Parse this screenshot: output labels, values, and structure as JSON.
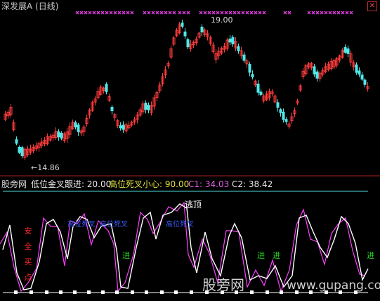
{
  "window": {
    "title": "深发展A (日线)",
    "close_icon": "close-icon"
  },
  "price_chart": {
    "high_label": "19.00",
    "low_label": "←14.86",
    "up_color": "#ff3c3c",
    "down_color": "#4fe8e8",
    "marker_color": "#e040e0"
  },
  "indicator": {
    "name": "股旁网",
    "param1": "低位金叉跟进: 20.00",
    "param2": "高位死叉小心: 90.00",
    "c1": "C1: 34.03",
    "c2": "C2: 38.42",
    "c1_color": "#ff40ff",
    "c2_color": "#ffffff",
    "escape_top_label": "逃顶",
    "blue_signals": [
      "高位死叉",
      "高位死叉",
      "高位死叉"
    ],
    "red_signal": [
      "安",
      "全",
      "买",
      "点"
    ],
    "green_signals": [
      "进",
      "进",
      "进",
      "进"
    ]
  },
  "watermark": {
    "text": "股旁网",
    "url": "www.gupang.com"
  }
}
